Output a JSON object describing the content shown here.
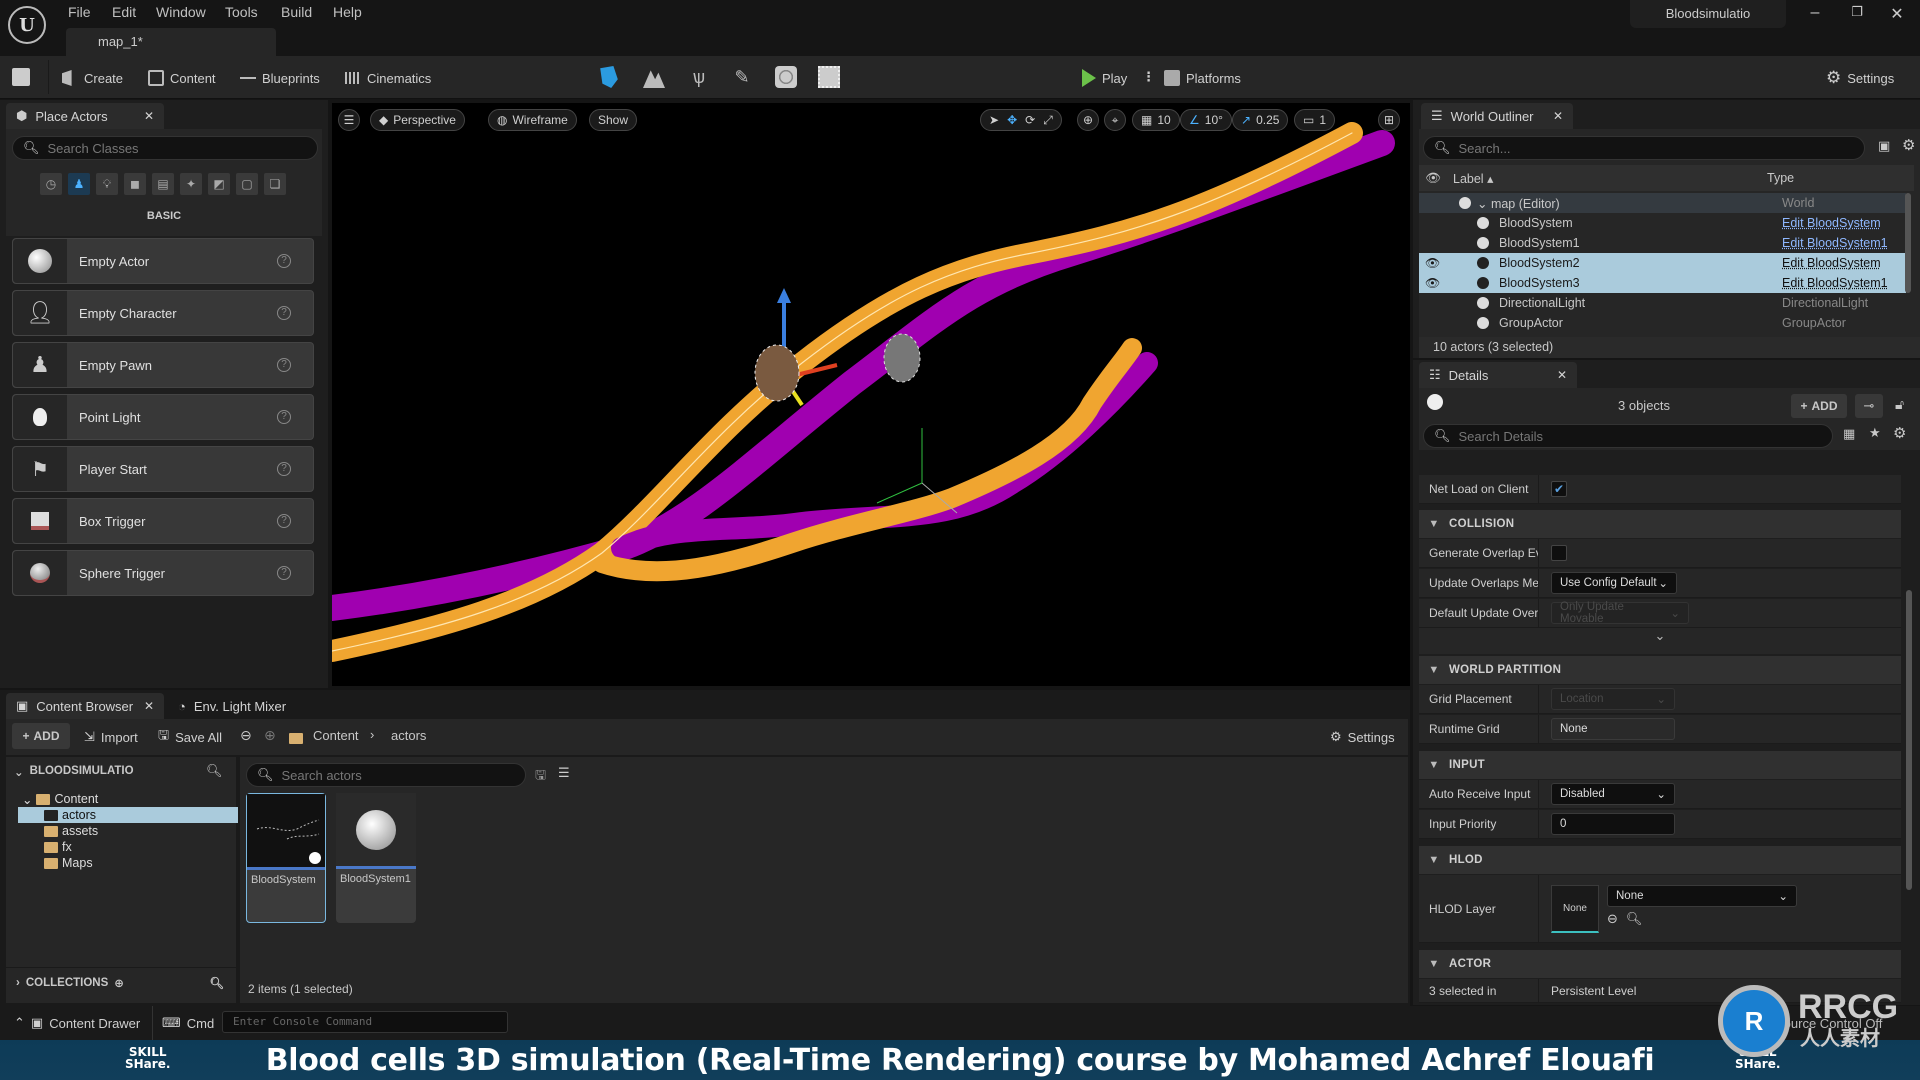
{
  "app": {
    "logo_text": "U",
    "menu": [
      "File",
      "Edit",
      "Window",
      "Tools",
      "Build",
      "Help"
    ],
    "level_tab": "map_1*",
    "project_name": "Bloodsimulatio",
    "window_controls": [
      "minimize",
      "restore",
      "close"
    ]
  },
  "toolbar": {
    "save_icon": "save-icon",
    "create": "Create",
    "content": "Content",
    "blueprints": "Blueprints",
    "cinematics": "Cinematics",
    "modes": [
      "select-mode",
      "landscape-mode",
      "foliage-mode",
      "mesh-paint-mode",
      "fracture-mode",
      "brush-edit-mode"
    ],
    "play": "Play",
    "platforms": "Platforms",
    "settings": "Settings"
  },
  "place_actors": {
    "tab_title": "Place Actors",
    "search_placeholder": "Search Classes",
    "category_label": "BASIC",
    "categories": [
      "recent",
      "basic",
      "lights",
      "shapes",
      "cinematic",
      "visual-effects",
      "geometry",
      "volumes",
      "all-classes"
    ],
    "items": [
      {
        "label": "Empty Actor",
        "icon": "empty-actor-icon"
      },
      {
        "label": "Empty Character",
        "icon": "character-icon"
      },
      {
        "label": "Empty Pawn",
        "icon": "pawn-icon"
      },
      {
        "label": "Point Light",
        "icon": "light-bulb-icon"
      },
      {
        "label": "Player Start",
        "icon": "player-start-icon"
      },
      {
        "label": "Box Trigger",
        "icon": "box-trigger-icon"
      },
      {
        "label": "Sphere Trigger",
        "icon": "sphere-trigger-icon"
      }
    ]
  },
  "viewport": {
    "menu_icon": "hamburger-icon",
    "perspective": "Perspective",
    "view_mode": "Wireframe",
    "show": "Show",
    "grid_snap": "10",
    "rotation_snap": "10°",
    "scale_snap": "0.25",
    "camera_speed": "1"
  },
  "outliner": {
    "tab_title": "World Outliner",
    "search_placeholder": "Search...",
    "col_label": "Label",
    "col_type": "Type",
    "rows": [
      {
        "label": "map (Editor)",
        "type": "World",
        "link": false,
        "selected": false,
        "visible_icon": false
      },
      {
        "label": "BloodSystem",
        "type": "Edit BloodSystem",
        "link": true,
        "selected": false,
        "visible_icon": false
      },
      {
        "label": "BloodSystem1",
        "type": "Edit BloodSystem1",
        "link": true,
        "selected": false,
        "visible_icon": false
      },
      {
        "label": "BloodSystem2",
        "type": "Edit BloodSystem",
        "link": true,
        "selected": true,
        "visible_icon": true
      },
      {
        "label": "BloodSystem3",
        "type": "Edit BloodSystem1",
        "link": true,
        "selected": true,
        "visible_icon": true
      },
      {
        "label": "DirectionalLight",
        "type": "DirectionalLight",
        "link": false,
        "selected": false,
        "visible_icon": false
      },
      {
        "label": "GroupActor",
        "type": "GroupActor",
        "link": false,
        "selected": false,
        "visible_icon": false
      }
    ],
    "footer": "10 actors (3 selected)"
  },
  "details": {
    "tab_title": "Details",
    "object_count": "3 objects",
    "add_label": "ADD",
    "search_placeholder": "Search Details",
    "net_load_label": "Net Load on Client",
    "net_load_checked": true,
    "sections": {
      "collision": "COLLISION",
      "world_partition": "WORLD PARTITION",
      "input": "INPUT",
      "hlod": "HLOD",
      "actor": "ACTOR"
    },
    "generate_overlap_label": "Generate Overlap Eve",
    "generate_overlap_checked": false,
    "update_overlaps_label": "Update Overlaps Met",
    "update_overlaps_value": "Use Config Default",
    "default_update_label": "Default Update Overl",
    "default_update_value": "Only Update Movable",
    "grid_placement_label": "Grid Placement",
    "grid_placement_value": "Location",
    "runtime_grid_label": "Runtime Grid",
    "runtime_grid_value": "None",
    "auto_receive_label": "Auto Receive Input",
    "auto_receive_value": "Disabled",
    "input_priority_label": "Input Priority",
    "input_priority_value": "0",
    "hlod_layer_label": "HLOD Layer",
    "hlod_thumb": "None",
    "hlod_value": "None",
    "selected_in_label": "3 selected in",
    "selected_in_value": "Persistent Level"
  },
  "content_browser": {
    "tab_title": "Content Browser",
    "tab2_title": "Env. Light Mixer",
    "add": "ADD",
    "import": "Import",
    "save_all": "Save All",
    "breadcrumb": [
      "Content",
      "actors"
    ],
    "settings": "Settings",
    "source_root": "BLOODSIMULATIO",
    "tree": [
      {
        "label": "Content",
        "depth": 0,
        "selected": false
      },
      {
        "label": "actors",
        "depth": 1,
        "selected": true
      },
      {
        "label": "assets",
        "depth": 1,
        "selected": false
      },
      {
        "label": "fx",
        "depth": 1,
        "selected": false
      },
      {
        "label": "Maps",
        "depth": 1,
        "selected": false
      }
    ],
    "collections": "COLLECTIONS",
    "search_placeholder": "Search actors",
    "assets": [
      {
        "label": "BloodSystem",
        "selected": true
      },
      {
        "label": "BloodSystem1",
        "selected": false
      }
    ],
    "item_count": "2 items (1 selected)"
  },
  "statusbar": {
    "content_drawer": "Content Drawer",
    "cmd": "Cmd",
    "console_placeholder": "Enter Console Command",
    "source_control": "Source Control Off"
  },
  "banner": {
    "title": "Blood cells 3D simulation (Real-Time Rendering) course by Mohamed Achref Elouafi",
    "brand_top": "SKILL",
    "brand_bottom": "SHare."
  },
  "watermark": {
    "brand": "RRCG",
    "subtitle": "人人素材"
  },
  "colors": {
    "accent_blue": "#2b9be0",
    "play_green": "#6cc24a",
    "vessel_orange": "#f0a530",
    "vessel_magenta": "#a000b0",
    "selection": "#aacbdc",
    "banner": "#0d3b57"
  }
}
